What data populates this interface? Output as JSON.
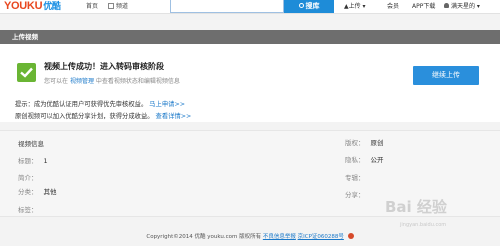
{
  "header": {
    "logo_en": "YOUKU",
    "logo_cn": "优酷",
    "nav_home": "首页",
    "nav_channel": "频道",
    "search_button": "搜库",
    "nav_upload": "上传 ▾",
    "nav_member": "会员",
    "nav_app": "APP下载",
    "nav_user": "满天星的 ▾"
  },
  "page_title": "上传视频",
  "success": {
    "title": "视频上传成功！进入转码审核阶段",
    "sub_prefix": "您可以在",
    "sub_link": "视频管理",
    "sub_suffix": "中查看视频状态和编辑视频信息",
    "continue_button": "继续上传",
    "tip1_text": "提示：成为优酷认证用户可获得优先审核权益。",
    "tip1_link": "马上申请>>",
    "tip2_text": "原创视频可以加入优酷分享计划，获得分成收益。",
    "tip2_link": "查看详情>>"
  },
  "video_info": {
    "heading": "视频信息",
    "title_label": "标题：",
    "title_value": "1",
    "intro_label": "简介：",
    "category_label": "分类：",
    "category_value": "其他",
    "tags_label": "标签：",
    "type_label": "版权：",
    "type_value": "原创",
    "privacy_label": "隐私：",
    "privacy_value": "公开",
    "album_label": "专辑：",
    "share_label": "分享："
  },
  "footer": {
    "copyright": "Copyright©2014 优酷 youku.com 版权所有",
    "link1": "不良信息举报",
    "link2": "京ICP证060288号"
  },
  "watermark": {
    "text": "Bai  经验",
    "sub": "jingyan.baidu.com"
  },
  "colors": {
    "accent": "#1e8cd8",
    "success": "#6ab534",
    "title_bar": "#6e6e6e"
  }
}
